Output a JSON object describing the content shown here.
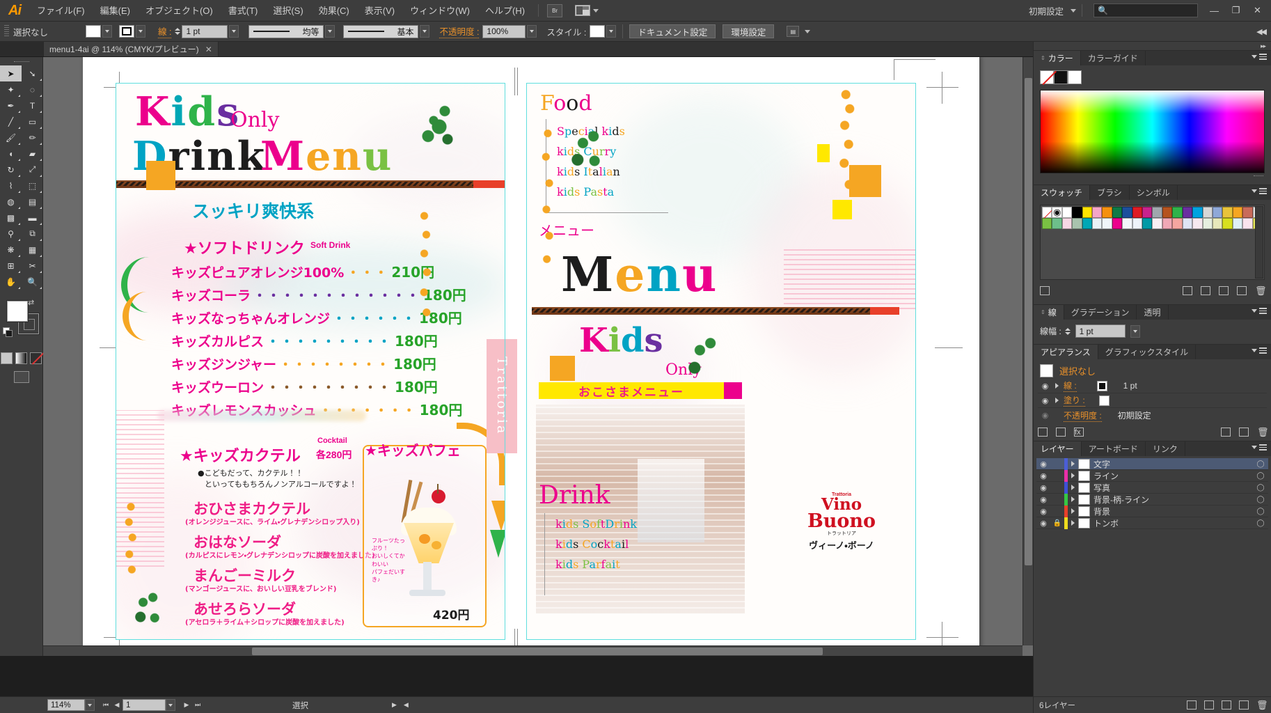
{
  "app": {
    "name": "Adobe Illustrator",
    "logo": "Ai",
    "workspace": "初期設定",
    "search_placeholder": "",
    "win_min": "—",
    "win_max": "❐",
    "win_close": "✕"
  },
  "menubar": {
    "items": [
      {
        "label": "ファイル(F)"
      },
      {
        "label": "編集(E)"
      },
      {
        "label": "オブジェクト(O)"
      },
      {
        "label": "書式(T)"
      },
      {
        "label": "選択(S)"
      },
      {
        "label": "効果(C)"
      },
      {
        "label": "表示(V)"
      },
      {
        "label": "ウィンドウ(W)"
      },
      {
        "label": "ヘルプ(H)"
      }
    ],
    "bridge_label": "Br"
  },
  "controlbar": {
    "selection_label": "選択なし",
    "stroke_label": "線 :",
    "stroke_weight": "1 pt",
    "profile_label": "均等",
    "brush_label": "基本",
    "opacity_label": "不透明度 :",
    "opacity_value": "100%",
    "style_label": "スタイル :",
    "document_setup": "ドキュメント設定",
    "preferences": "環境設定"
  },
  "document": {
    "tab_title": "menu1-4ai @ 114% (CMYK/プレビュー)",
    "close_glyph": "✕"
  },
  "toolbar": {
    "tools": [
      {
        "name": "selection-tool",
        "glyph": "➤",
        "selected": true
      },
      {
        "name": "direct-selection-tool",
        "glyph": "➘",
        "selected": false
      },
      {
        "name": "magic-wand-tool",
        "glyph": "✦",
        "selected": false
      },
      {
        "name": "lasso-tool",
        "glyph": "◌",
        "selected": false
      },
      {
        "name": "pen-tool",
        "glyph": "✒",
        "selected": false
      },
      {
        "name": "type-tool",
        "glyph": "T",
        "selected": false
      },
      {
        "name": "line-segment-tool",
        "glyph": "╱",
        "selected": false
      },
      {
        "name": "rectangle-tool",
        "glyph": "▭",
        "selected": false
      },
      {
        "name": "paintbrush-tool",
        "glyph": "🖌",
        "selected": false
      },
      {
        "name": "pencil-tool",
        "glyph": "✏",
        "selected": false
      },
      {
        "name": "blob-brush-tool",
        "glyph": "◖",
        "selected": false
      },
      {
        "name": "eraser-tool",
        "glyph": "▰",
        "selected": false
      },
      {
        "name": "rotate-tool",
        "glyph": "↻",
        "selected": false
      },
      {
        "name": "scale-tool",
        "glyph": "⤢",
        "selected": false
      },
      {
        "name": "width-tool",
        "glyph": "⌇",
        "selected": false
      },
      {
        "name": "free-transform-tool",
        "glyph": "⬚",
        "selected": false
      },
      {
        "name": "shape-builder-tool",
        "glyph": "◍",
        "selected": false
      },
      {
        "name": "perspective-grid-tool",
        "glyph": "▤",
        "selected": false
      },
      {
        "name": "mesh-tool",
        "glyph": "▩",
        "selected": false
      },
      {
        "name": "gradient-tool",
        "glyph": "▬",
        "selected": false
      },
      {
        "name": "eyedropper-tool",
        "glyph": "⚲",
        "selected": false
      },
      {
        "name": "blend-tool",
        "glyph": "⧉",
        "selected": false
      },
      {
        "name": "symbol-sprayer-tool",
        "glyph": "❋",
        "selected": false
      },
      {
        "name": "column-graph-tool",
        "glyph": "▦",
        "selected": false
      },
      {
        "name": "artboard-tool",
        "glyph": "⊞",
        "selected": false
      },
      {
        "name": "slice-tool",
        "glyph": "✂",
        "selected": false
      },
      {
        "name": "hand-tool",
        "glyph": "✋",
        "selected": false
      },
      {
        "name": "zoom-tool",
        "glyph": "🔍",
        "selected": false
      }
    ],
    "fill_color": "#ffffff",
    "stroke_color": "#000000"
  },
  "canvas": {
    "left_page": {
      "title_kids": "Kids",
      "title_only": "Only",
      "title_drink": "Drink",
      "title_menu": "Menu",
      "section_refresh": "スッキリ爽快系",
      "soft_drink_head_jp": "★ソフトドリンク",
      "soft_drink_head_en": "Soft Drink",
      "drinks": [
        {
          "name": "キッズピュアオレンジ100%",
          "dots": "・・・",
          "price": "210円"
        },
        {
          "name": "キッズコーラ",
          "dots": "・・・・・・・・・・・・",
          "price": "180円"
        },
        {
          "name": "キッズなっちゃんオレンジ",
          "dots": "・・・・・・",
          "price": "180円"
        },
        {
          "name": "キッズカルピス",
          "dots": "・・・・・・・・・",
          "price": "180円"
        },
        {
          "name": "キッズジンジャー",
          "dots": "・・・・・・・・",
          "price": "180円"
        },
        {
          "name": "キッズウーロン",
          "dots": "・・・・・・・・・",
          "price": "180円"
        },
        {
          "name": "キッズレモンスカッシュ",
          "dots": "・・・・・・・",
          "price": "180円"
        }
      ],
      "cocktail_head": "★キッズカクテル",
      "cocktail_en": "Cocktail",
      "cocktail_price": "各280円",
      "cocktail_note1": "●こどもだって、カクテル！！",
      "cocktail_note2": "といってももちろんノンアルコールですよ！",
      "cocktails": [
        {
          "name": "おひさまカクテル",
          "desc": "(オレンジジュースに、ライム・グレナデンシロップ入り)"
        },
        {
          "name": "おはなソーダ",
          "desc": "(カルピスにレモン・グレナデンシロップに炭酸を加えました)"
        },
        {
          "name": "まんごーミルク",
          "desc": "(マンゴージュースに、おいしい豆乳をブレンド)"
        },
        {
          "name": "あせろらソーダ",
          "desc": "(アセロラ＋ライム＋シロップに炭酸を加えました)"
        }
      ],
      "parfait_head": "★キッズパフェ",
      "parfait_note": "フルーツたっぷり！\nおいしくてかわいい\nパフェだいすき♪",
      "parfait_price": "420円",
      "trattoria": "Trattoria"
    },
    "right_page": {
      "food_head": "Food",
      "food_items": [
        "Special kids",
        "kids Curry",
        "kids Italian",
        "kids Pasta"
      ],
      "menu_jp": "メニュー",
      "menu_big": "Menu",
      "kids_big": "Kids",
      "only": "Only",
      "okosama": "おこさまメニュー",
      "drink_big": "Drink",
      "drink_items": [
        "kids SoftDrink",
        "kids Cocktail",
        "kids Parfait"
      ],
      "logo_small": "Trattoria",
      "logo_line1": "Vino",
      "logo_line2": "Buono",
      "logo_jp_small": "トラットリア",
      "logo_jp": "ヴィーノ・ボーノ"
    }
  },
  "statusbar": {
    "zoom": "114%",
    "page": "1",
    "status_text": "選択",
    "first_glyph": "⏮",
    "prev_glyph": "◀",
    "next_glyph": "▶",
    "last_glyph": "⏭"
  },
  "panels": {
    "color": {
      "tabs": [
        {
          "label": "カラー",
          "active": true
        },
        {
          "label": "カラーガイド",
          "active": false
        }
      ],
      "chips": [
        "none",
        "#000000",
        "#ffffff"
      ]
    },
    "swatches": {
      "tabs": [
        {
          "label": "スウォッチ",
          "active": true
        },
        {
          "label": "ブラシ",
          "active": false
        },
        {
          "label": "シンボル",
          "active": false
        }
      ],
      "row1": [
        "none",
        "registration",
        "#ffffff",
        "#000000",
        "#ffe400",
        "#f4a6c8",
        "#f5910f",
        "#0d7a46",
        "#1c4f9c",
        "#e01b24",
        "#c9228e",
        "#a0a6ad",
        "#b5531f",
        "#2fb34a",
        "#6a2fa0",
        "#00a3e0",
        "#d7d7d7",
        "#8fa8d8",
        "#e8c33a",
        "#f5a623",
        "#c96b5a",
        "#e4e4e4"
      ],
      "row2": [
        "#7ac143",
        "#6dbf8b",
        "#f6d8e4",
        "#a9c3ae",
        "#00a7b5",
        "#eaf3f7",
        "#f0f6fa",
        "#ec008c",
        "#f3f6fb",
        "#eef3fa",
        "#009aa6",
        "#fbeff4",
        "#f1a8b6",
        "#f5a6a0",
        "#dfe4f5",
        "#f7e8f0",
        "#e7efe0",
        "#e8e9bb",
        "#d8e020",
        "#dff1f6",
        "#fbe4ee",
        "#e8e85c"
      ]
    },
    "stroke": {
      "tabs": [
        {
          "label": "線",
          "active": true
        },
        {
          "label": "グラデーション",
          "active": false
        },
        {
          "label": "透明",
          "active": false
        }
      ],
      "weight_label": "線幅 :",
      "weight_value": "1 pt"
    },
    "appearance": {
      "tabs": [
        {
          "label": "アピアランス",
          "active": true
        },
        {
          "label": "グラフィックスタイル",
          "active": false
        }
      ],
      "target": "選択なし",
      "rows": [
        {
          "label": "線 :",
          "value": "1 pt",
          "swatch": "black"
        },
        {
          "label": "塗り :",
          "value": "",
          "swatch": "white"
        },
        {
          "label": "不透明度 :",
          "value": "初期設定",
          "swatch": null
        }
      ]
    },
    "layers": {
      "tabs": [
        {
          "label": "レイヤー",
          "active": true
        },
        {
          "label": "アートボード",
          "active": false
        },
        {
          "label": "リンク",
          "active": false
        }
      ],
      "items": [
        {
          "name": "文字",
          "color": "#4b5ed7",
          "locked": false,
          "selected": true
        },
        {
          "name": "ライン",
          "color": "#ea2fa8",
          "locked": false,
          "selected": false
        },
        {
          "name": "写真",
          "color": "#3f4fd6",
          "locked": false,
          "selected": false
        },
        {
          "name": "背景-柄-ライン",
          "color": "#35c744",
          "locked": false,
          "selected": false
        },
        {
          "name": "背景",
          "color": "#e8402a",
          "locked": false,
          "selected": false
        },
        {
          "name": "トンボ",
          "color": "#eddb1e",
          "locked": true,
          "selected": false
        }
      ],
      "count_label": "6レイヤー"
    }
  }
}
